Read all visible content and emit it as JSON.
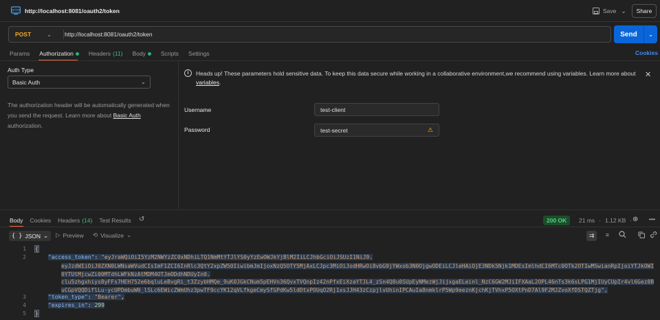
{
  "titlebar": {
    "url": "http://localhost:8081/oauth2/token",
    "save_label": "Save",
    "share_label": "Share"
  },
  "request": {
    "method": "POST",
    "url": "http://localhost:8081/oauth2/token",
    "send_label": "Send",
    "cookies_label": "Cookies",
    "tabs": [
      {
        "label": "Params"
      },
      {
        "label": "Authorization"
      },
      {
        "label": "Headers",
        "count": "(11)"
      },
      {
        "label": "Body"
      },
      {
        "label": "Scripts"
      },
      {
        "label": "Settings"
      }
    ]
  },
  "auth": {
    "type_label": "Auth Type",
    "type_value": "Basic Auth",
    "desc_pre": "The authorization header will be automatically generated when you send the request. Learn more about ",
    "desc_link": "Basic Auth",
    "desc_post": " authorization.",
    "warning_pre": "Heads up! These parameters hold sensitive data. To keep this data secure while working in a collaborative environment,we recommend using variables. Learn more about ",
    "warning_link": "variables",
    "warning_post": ".",
    "username_label": "Username",
    "username_value": "test-client",
    "password_label": "Password",
    "password_value": "test-secret"
  },
  "response": {
    "tabs": [
      {
        "label": "Body"
      },
      {
        "label": "Cookies"
      },
      {
        "label": "Headers",
        "count": "(14)"
      },
      {
        "label": "Test Results"
      }
    ],
    "status": "200 OK",
    "time": "21 ms",
    "size": "1.12 KB",
    "format": "JSON",
    "preview_label": "Preview",
    "visualize_label": "Visualize",
    "code": {
      "line_numbers": [
        "1",
        "2",
        "",
        "",
        "",
        "",
        "",
        "3",
        "4",
        "5"
      ],
      "open_brace": "{",
      "close_brace": "}",
      "access_token_key": "\"access_token\"",
      "access_token_lines": [
        "\"eyJraWQiOiI5YzM2NWYzZC0xNDhiLTQ1NmMtYTJlYS0yYzEwOWJkYjBlM2IiLCJhbGciOiJSUzI1NiJ9.",
        "eyJzdWIiOiJ0ZXN0LWNsaWVudCIsImF1ZCI6InRlc3QtY2xpZW50IiwibmJmIjoxNzQ5OTY5MjAxLCJpc3MiOiJodHRwOi8vbG9jYWxob3N0OjgwODEiLCJleHAiOjE3NDk5Njk1MDEsImlhdCI6MTc0OTk2OTIwMSwianRpIjoiYTJkOWI0YTUtMjcwZi00MTdhLWFkNzAtMDM4OTJmODdhNDUyIn0.",
        "clu5zhgxhiys8yFFs7HEH752e6bqluLeBvgRi_t3ZzybHMQe_9uK0JGkCNum5pEHVn36QvxTVQnpIz42nPfxEiXzaYTJL4_zSn4Q8u0SUpEyNMezWjJijxgaELeinl_NzC6GW2MJiIFXAaL2OPL46nTs3k6sLPG1MjIUyCUpIr4vl6Gez8BuCGpVQQDiflLu-ycUPDmbuW0_lSLc6EWicZWmUhz3pwTF9ccYK12qVLfkgeCmySfGPdKw5ldDtxPOUqO2Rj1xsJJH43zCzpjlvUhinIPCAuIa8nmklrP5Wp9eeznKjchKjTVhxP5OXtPnD7Al9F2MJZvoXfDSTQZTjg\","
      ],
      "token_type_key": "\"token_type\"",
      "token_type_value": "\"Bearer\"",
      "expires_in_key": "\"expires_in\"",
      "expires_in_value": "299"
    }
  },
  "colors": {
    "accent": "#f26b3a",
    "send": "#0a66d8",
    "method": "#f5a623",
    "status_ok": "#4fd27e"
  }
}
